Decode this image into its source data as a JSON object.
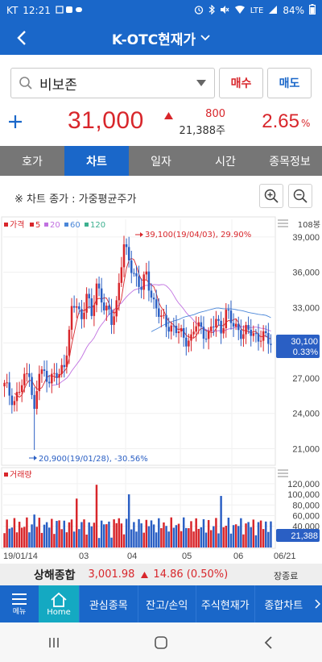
{
  "status_bar": {
    "carrier": "KT",
    "time": "12:21",
    "network": "LTE",
    "battery": "84%"
  },
  "header": {
    "title": "K-OTC현재가"
  },
  "search": {
    "stock_name": "비보존"
  },
  "actions": {
    "buy_label": "매수",
    "sell_label": "매도"
  },
  "quote": {
    "price": "31,000",
    "change": "800",
    "volume": "21,388주",
    "change_pct": "2.65",
    "pct_unit": "%"
  },
  "tabs": [
    {
      "label": "호가"
    },
    {
      "label": "차트"
    },
    {
      "label": "일자"
    },
    {
      "label": "시간"
    },
    {
      "label": "종목정보"
    }
  ],
  "active_tab": "차트",
  "chart_note": "※ 차트 종가 : 가중평균주가",
  "chart_data": {
    "type": "candlestick",
    "bars_count_label": "108봉",
    "legend": [
      {
        "name": "가격",
        "color": "#d8262b"
      },
      {
        "name": "5",
        "color": "#d8262b"
      },
      {
        "name": "20",
        "color": "#c070e0"
      },
      {
        "name": "60",
        "color": "#4a86d8"
      },
      {
        "name": "120",
        "color": "#3cb08f"
      }
    ],
    "y_ticks": [
      "39,000",
      "36,000",
      "33,000",
      "30,000",
      "27,000",
      "24,000",
      "21,000"
    ],
    "y_tick_values": [
      39000,
      36000,
      33000,
      30000,
      27000,
      24000,
      21000
    ],
    "ylim": [
      19800,
      40500
    ],
    "x_ticks": [
      "19/01/14",
      "03",
      "04",
      "05",
      "06",
      "06/21"
    ],
    "current_price_label": "30,100",
    "current_pct_label": "0.33%",
    "high_annotation": "39,100(19/04/03), 29.90%",
    "low_annotation": "20,900(19/01/28), -30.56%",
    "volume_label": "거래량",
    "volume_ticks": [
      "120,000",
      "100,000",
      "80,000",
      "60,000",
      "40,000"
    ],
    "volume_tick_values": [
      120000,
      100000,
      80000,
      60000,
      40000
    ],
    "volume_current_label": "21,388",
    "key_points": [
      {
        "date": "19/01/28",
        "value": 20900
      },
      {
        "date": "19/04/03",
        "value": 39100
      },
      {
        "date": "06/21",
        "value": 30100
      }
    ]
  },
  "market": {
    "name": "상해종합",
    "value": "3,001.98",
    "change": "14.86 (0.50%)",
    "status": "장종료"
  },
  "bottom_nav": {
    "menu_label": "메뉴",
    "home_label": "Home",
    "items": [
      "관심종목",
      "잔고/손익",
      "주식현재가",
      "종합차트"
    ]
  },
  "colors": {
    "brand_blue": "#1a67c9",
    "up_red": "#d8262b",
    "down_blue": "#2a5fc4",
    "home_teal": "#14a9c2"
  }
}
